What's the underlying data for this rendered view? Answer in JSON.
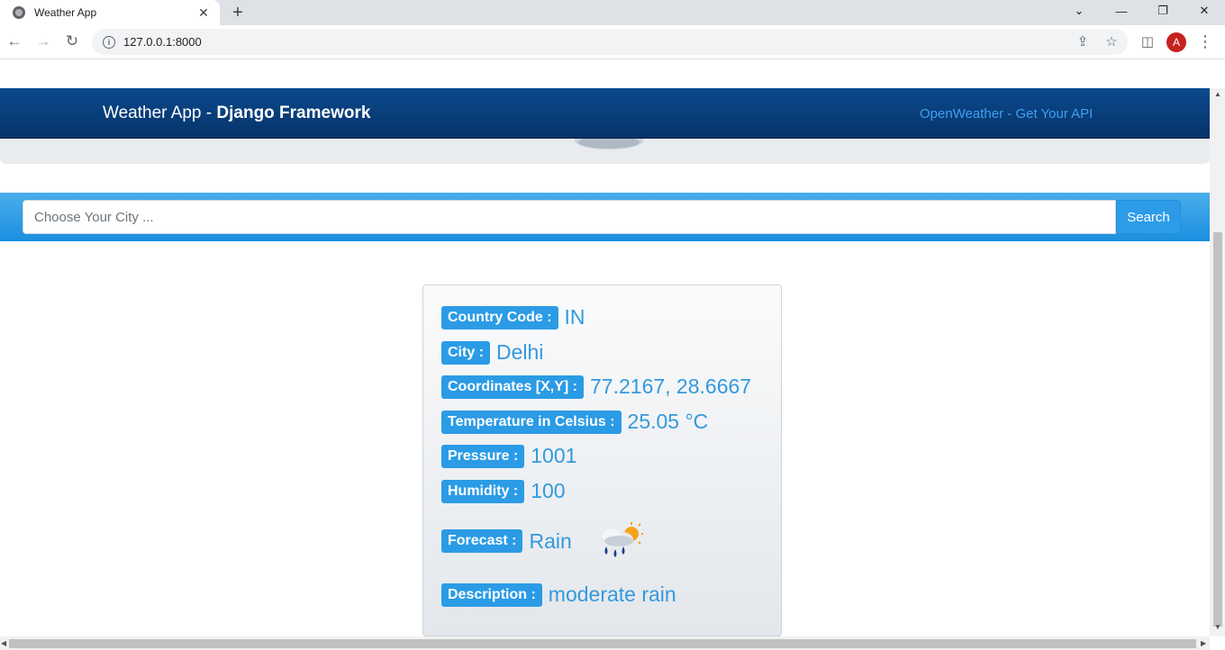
{
  "browser": {
    "tab_title": "Weather App",
    "tab_close": "✕",
    "new_tab": "+",
    "url": "127.0.0.1:8000",
    "avatar_letter": "A",
    "window_controls": {
      "chevron": "⌄",
      "minimize": "—",
      "restore": "❐",
      "close": "✕"
    },
    "icons": {
      "back": "←",
      "forward": "→",
      "reload": "↻",
      "share": "⇪",
      "star": "☆",
      "sidepanel": "◫",
      "menu": "⋮",
      "info": "i"
    }
  },
  "navbar": {
    "brand_prefix": "Weather App - ",
    "brand_bold": "Django Framework",
    "api_link": "OpenWeather - Get Your API"
  },
  "search": {
    "placeholder": "Choose Your City ...",
    "button_label": "Search"
  },
  "weather": {
    "country_code_label": "Country Code :",
    "country_code": "IN",
    "city_label": "City :",
    "city": "Delhi",
    "coordinates_label": "Coordinates [X,Y] :",
    "coordinates": "77.2167, 28.6667",
    "temperature_label": "Temperature in Celsius :",
    "temperature": "25.05 °C",
    "pressure_label": "Pressure :",
    "pressure": "1001",
    "humidity_label": "Humidity :",
    "humidity": "100",
    "forecast_label": "Forecast :",
    "forecast": "Rain",
    "forecast_icon": "rain-sun-icon",
    "description_label": "Description :",
    "description": "moderate rain"
  },
  "colors": {
    "navbar": "#0b4a8c",
    "badge": "#2b9be6",
    "value_text": "#3399dd",
    "search_band": "#1b8fe0"
  }
}
